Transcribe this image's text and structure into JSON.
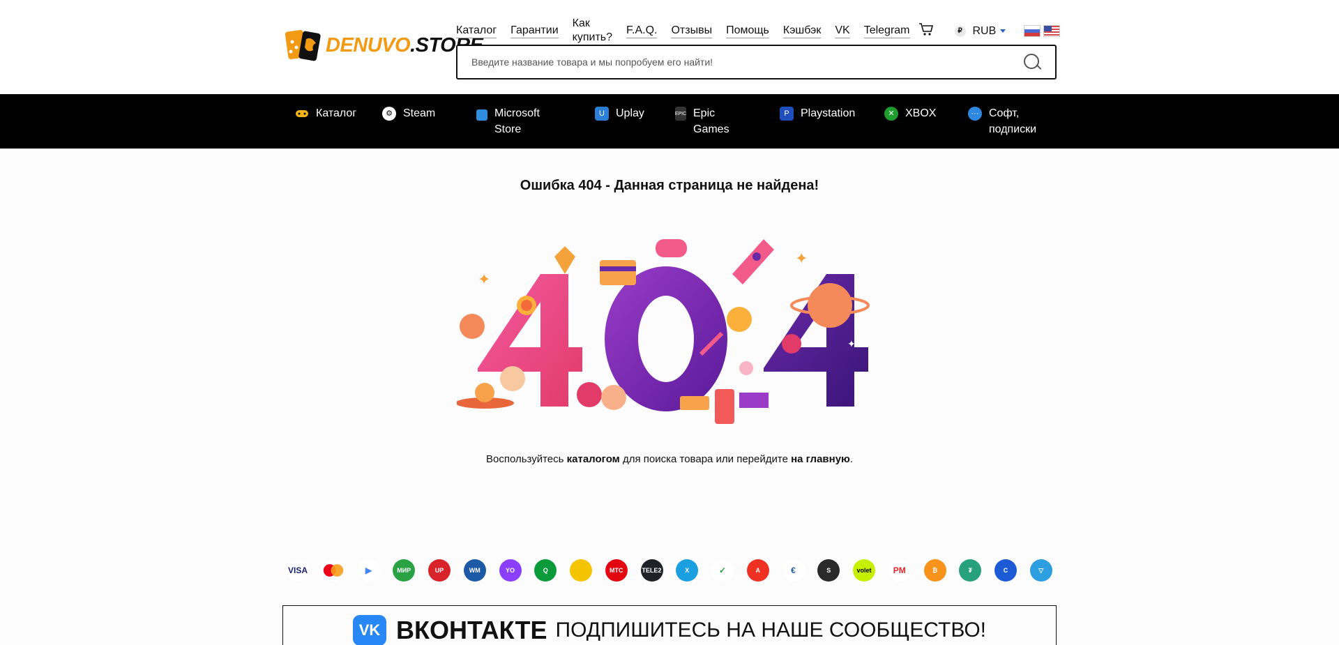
{
  "brand": {
    "logo_part1": "DENUVO",
    "logo_part2": ".STORE"
  },
  "topnav": {
    "items": [
      "Каталог",
      "Гарантии",
      "Как купить?",
      "F.A.Q.",
      "Отзывы",
      "Помощь",
      "Кэшбэк",
      "VK",
      "Telegram"
    ],
    "currency": "RUB",
    "currency_symbol": "₽"
  },
  "search": {
    "placeholder": "Введите название товара и мы попробуем его найти!"
  },
  "categories": [
    {
      "label": "Каталог",
      "icon": "gamepad-icon",
      "color": "#f2b41a"
    },
    {
      "label": "Steam",
      "icon": "steam-icon",
      "color": "#ffffff"
    },
    {
      "label": "Microsoft Store",
      "icon": "microsoft-store-icon",
      "color": "#2f8de0"
    },
    {
      "label": "Uplay",
      "icon": "uplay-icon",
      "color": "#2c7fd6"
    },
    {
      "label": "Epic Games",
      "icon": "epic-games-icon",
      "color": "#333333"
    },
    {
      "label": "Playstation",
      "icon": "playstation-icon",
      "color": "#1f4fbf"
    },
    {
      "label": "XBOX",
      "icon": "xbox-icon",
      "color": "#1f9c2e"
    },
    {
      "label": "Софт, подписки",
      "icon": "more-icon",
      "color": "#2e88e0"
    }
  ],
  "error": {
    "title": "Ошибка 404 - Данная страница не найдена!",
    "hint_prefix": "Воспользуйтесь ",
    "hint_catalog": "каталогом",
    "hint_middle": " для поиска товара или перейдите ",
    "hint_home": "на главную",
    "hint_suffix": ".",
    "art_text": "404"
  },
  "payments": [
    {
      "name": "visa-icon",
      "label": "VISA",
      "color": "#ffffff",
      "fg": "#1a1f71"
    },
    {
      "name": "mastercard-icon",
      "label": "",
      "color": "#ffffff",
      "fg": "#eb001b"
    },
    {
      "name": "google-play-icon",
      "label": "▶",
      "color": "#ffffff",
      "fg": "#4285f4"
    },
    {
      "name": "mir-icon",
      "label": "МИР",
      "color": "#2aa243",
      "fg": "#ffffff"
    },
    {
      "name": "unionpay-icon",
      "label": "UP",
      "color": "#d8232a",
      "fg": "#ffffff"
    },
    {
      "name": "webmoney-icon",
      "label": "WM",
      "color": "#1d5aa6",
      "fg": "#ffffff"
    },
    {
      "name": "yoomoney-icon",
      "label": "YO",
      "color": "#8b3ffd",
      "fg": "#ffffff"
    },
    {
      "name": "qiwi-icon",
      "label": "Q",
      "color": "#0b9b3a",
      "fg": "#ffffff"
    },
    {
      "name": "beeline-icon",
      "label": "",
      "color": "#f5c400",
      "fg": "#000000"
    },
    {
      "name": "mts-icon",
      "label": "МТС",
      "color": "#e30611",
      "fg": "#ffffff"
    },
    {
      "name": "tele2-icon",
      "label": "TELE2",
      "color": "#1f2229",
      "fg": "#ffffff"
    },
    {
      "name": "sber-x-icon",
      "label": "X",
      "color": "#1a9fe0",
      "fg": "#ffffff"
    },
    {
      "name": "sberpay-icon",
      "label": "✓",
      "color": "#ffffff",
      "fg": "#21a038"
    },
    {
      "name": "alfa-icon",
      "label": "A",
      "color": "#ef3124",
      "fg": "#ffffff"
    },
    {
      "name": "euro-icon",
      "label": "€",
      "color": "#ffffff",
      "fg": "#1d5aa6"
    },
    {
      "name": "steam-pay-icon",
      "label": "S",
      "color": "#2a2a2a",
      "fg": "#ffffff"
    },
    {
      "name": "volet-icon",
      "label": "volet",
      "color": "#c7f000",
      "fg": "#000000"
    },
    {
      "name": "perfect-money-icon",
      "label": "PM",
      "color": "#ffffff",
      "fg": "#e3262b"
    },
    {
      "name": "bitcoin-icon",
      "label": "₿",
      "color": "#f7931a",
      "fg": "#ffffff"
    },
    {
      "name": "tether-icon",
      "label": "₮",
      "color": "#26a17b",
      "fg": "#ffffff"
    },
    {
      "name": "c-icon",
      "label": "C",
      "color": "#1d5ad6",
      "fg": "#ffffff"
    },
    {
      "name": "tron-icon",
      "label": "▽",
      "color": "#2d9ee0",
      "fg": "#ffffff"
    }
  ],
  "vk_banner": {
    "logo": "VK",
    "word": "ВКОНТАКТЕ",
    "text": "ПОДПИШИТЕСЬ НА НАШЕ СООБЩЕСТВО!"
  }
}
